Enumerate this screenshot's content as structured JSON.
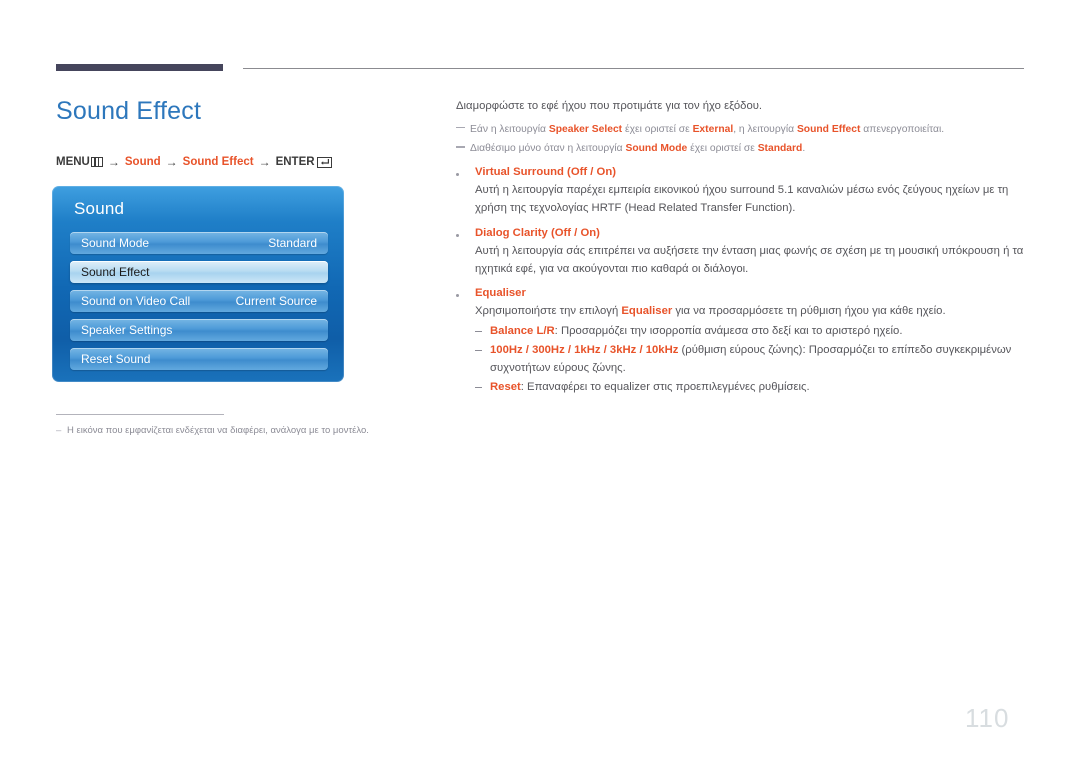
{
  "header": {
    "rule_dark_color": "#45455c",
    "rule_thin_color": "#8b8b90"
  },
  "left": {
    "title": "Sound Effect",
    "menu_path": {
      "menu_label": "MENU",
      "menu_icon": "menu-grid-icon",
      "arrow": "→",
      "step1": "Sound",
      "step2": "Sound Effect",
      "enter_label": "ENTER",
      "enter_icon": "enter-return-icon"
    }
  },
  "osd": {
    "heading": "Sound",
    "rows": [
      {
        "label": "Sound Mode",
        "value": "Standard",
        "selected": false
      },
      {
        "label": "Sound Effect",
        "value": "",
        "selected": true
      },
      {
        "label": "Sound on Video Call",
        "value": "Current Source",
        "selected": false
      },
      {
        "label": "Speaker Settings",
        "value": "",
        "selected": false
      },
      {
        "label": "Reset Sound",
        "value": "",
        "selected": false
      }
    ]
  },
  "footnote": {
    "dash": "–",
    "text": "Η εικόνα που εμφανίζεται ενδέχεται να διαφέρει, ανάλογα με το μοντέλο."
  },
  "right": {
    "intro": "Διαμορφώστε το εφέ ήχου που προτιμάτε για τον ήχο εξόδου.",
    "note1": {
      "a": "Εάν η λειτουργία ",
      "b": "Speaker Select",
      "c": " έχει οριστεί σε ",
      "d": "External",
      "e": ", η λειτουργία ",
      "f": "Sound Effect",
      "g": " απενεργοποιείται."
    },
    "note2": {
      "a": "Διαθέσιμο μόνο όταν η λειτουργία ",
      "b": "Sound Mode",
      "c": " έχει οριστεί σε ",
      "d": "Standard",
      "e": "."
    },
    "bullets": [
      {
        "title_main": "Virtual Surround",
        "title_options": " (Off / On)",
        "body": "Αυτή η λειτουργία παρέχει εμπειρία εικονικού ήχου surround 5.1 καναλιών μέσω ενός ζεύγους ηχείων με τη χρήση της τεχνολογίας HRTF (Head Related Transfer Function)."
      },
      {
        "title_main": "Dialog Clarity",
        "title_options": " (Off / On)",
        "body": "Αυτή η λειτουργία σάς επιτρέπει να αυξήσετε την ένταση μιας φωνής σε σχέση με τη μουσική υπόκρουση ή τα ηχητικά εφέ, για να ακούγονται πιο καθαρά οι διάλογοι."
      }
    ],
    "equaliser": {
      "title": "Equaliser",
      "body_a": "Χρησιμοποιήστε την επιλογή ",
      "body_term": "Equaliser",
      "body_b": " για να προσαρμόσετε τη ρύθμιση ήχου για κάθε ηχείο.",
      "sub": [
        {
          "term": "Balance L/R",
          "rest": ": Προσαρμόζει την ισορροπία ανάμεσα στο δεξί και το αριστερό ηχείο."
        },
        {
          "term": "100Hz / 300Hz / 1kHz / 3kHz / 10kHz",
          "rest": " (ρύθμιση εύρους ζώνης): Προσαρμόζει το επίπεδο συγκεκριμένων συχνοτήτων εύρους ζώνης."
        },
        {
          "term": "Reset",
          "rest": ": Επαναφέρει το equalizer στις προεπιλεγμένες ρυθμίσεις."
        }
      ],
      "dash": "–"
    }
  },
  "page_number": "110"
}
